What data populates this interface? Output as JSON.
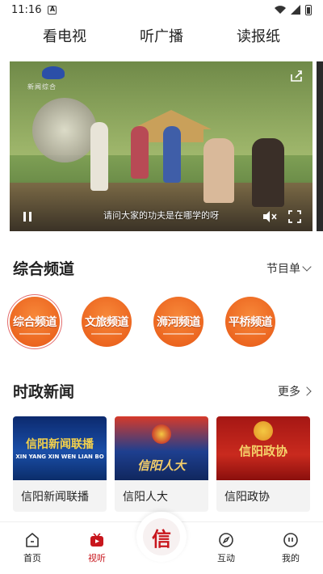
{
  "status_bar": {
    "time": "11:16",
    "notify_glyph": "A"
  },
  "top_tabs": [
    {
      "label": "看电视",
      "active": true
    },
    {
      "label": "听广播",
      "active": false
    },
    {
      "label": "读报纸",
      "active": false
    }
  ],
  "video": {
    "logo_text": "新闻综合",
    "subtitle": "请问大家的功夫是在哪学的呀"
  },
  "channels_section": {
    "title": "综合频道",
    "more_label": "节目单",
    "items": [
      {
        "label": "综合频道",
        "active": true
      },
      {
        "label": "文旅频道",
        "active": false
      },
      {
        "label": "浉河频道",
        "active": false
      },
      {
        "label": "平桥频道",
        "active": false
      }
    ]
  },
  "news_section": {
    "title": "时政新闻",
    "more_label": "更多",
    "items": [
      {
        "thumb_title": "信阳新闻联播",
        "thumb_sub": "XIN YANG XIN WEN LIAN BO",
        "caption": "信阳新闻联播"
      },
      {
        "thumb_title": "信阳人大",
        "caption": "信阳人大"
      },
      {
        "thumb_title": "信阳政协",
        "caption": "信阳政协"
      }
    ]
  },
  "bottom_nav": {
    "items": [
      {
        "label": "首页",
        "icon": "home-icon",
        "active": false
      },
      {
        "label": "视听",
        "icon": "tv-icon",
        "active": true
      },
      {
        "label": "互动",
        "icon": "compass-icon",
        "active": false
      },
      {
        "label": "我的",
        "icon": "user-icon",
        "active": false
      }
    ],
    "center_glyph": "信"
  },
  "colors": {
    "brand_red": "#c8161d",
    "channel_orange": "#ec6620"
  }
}
